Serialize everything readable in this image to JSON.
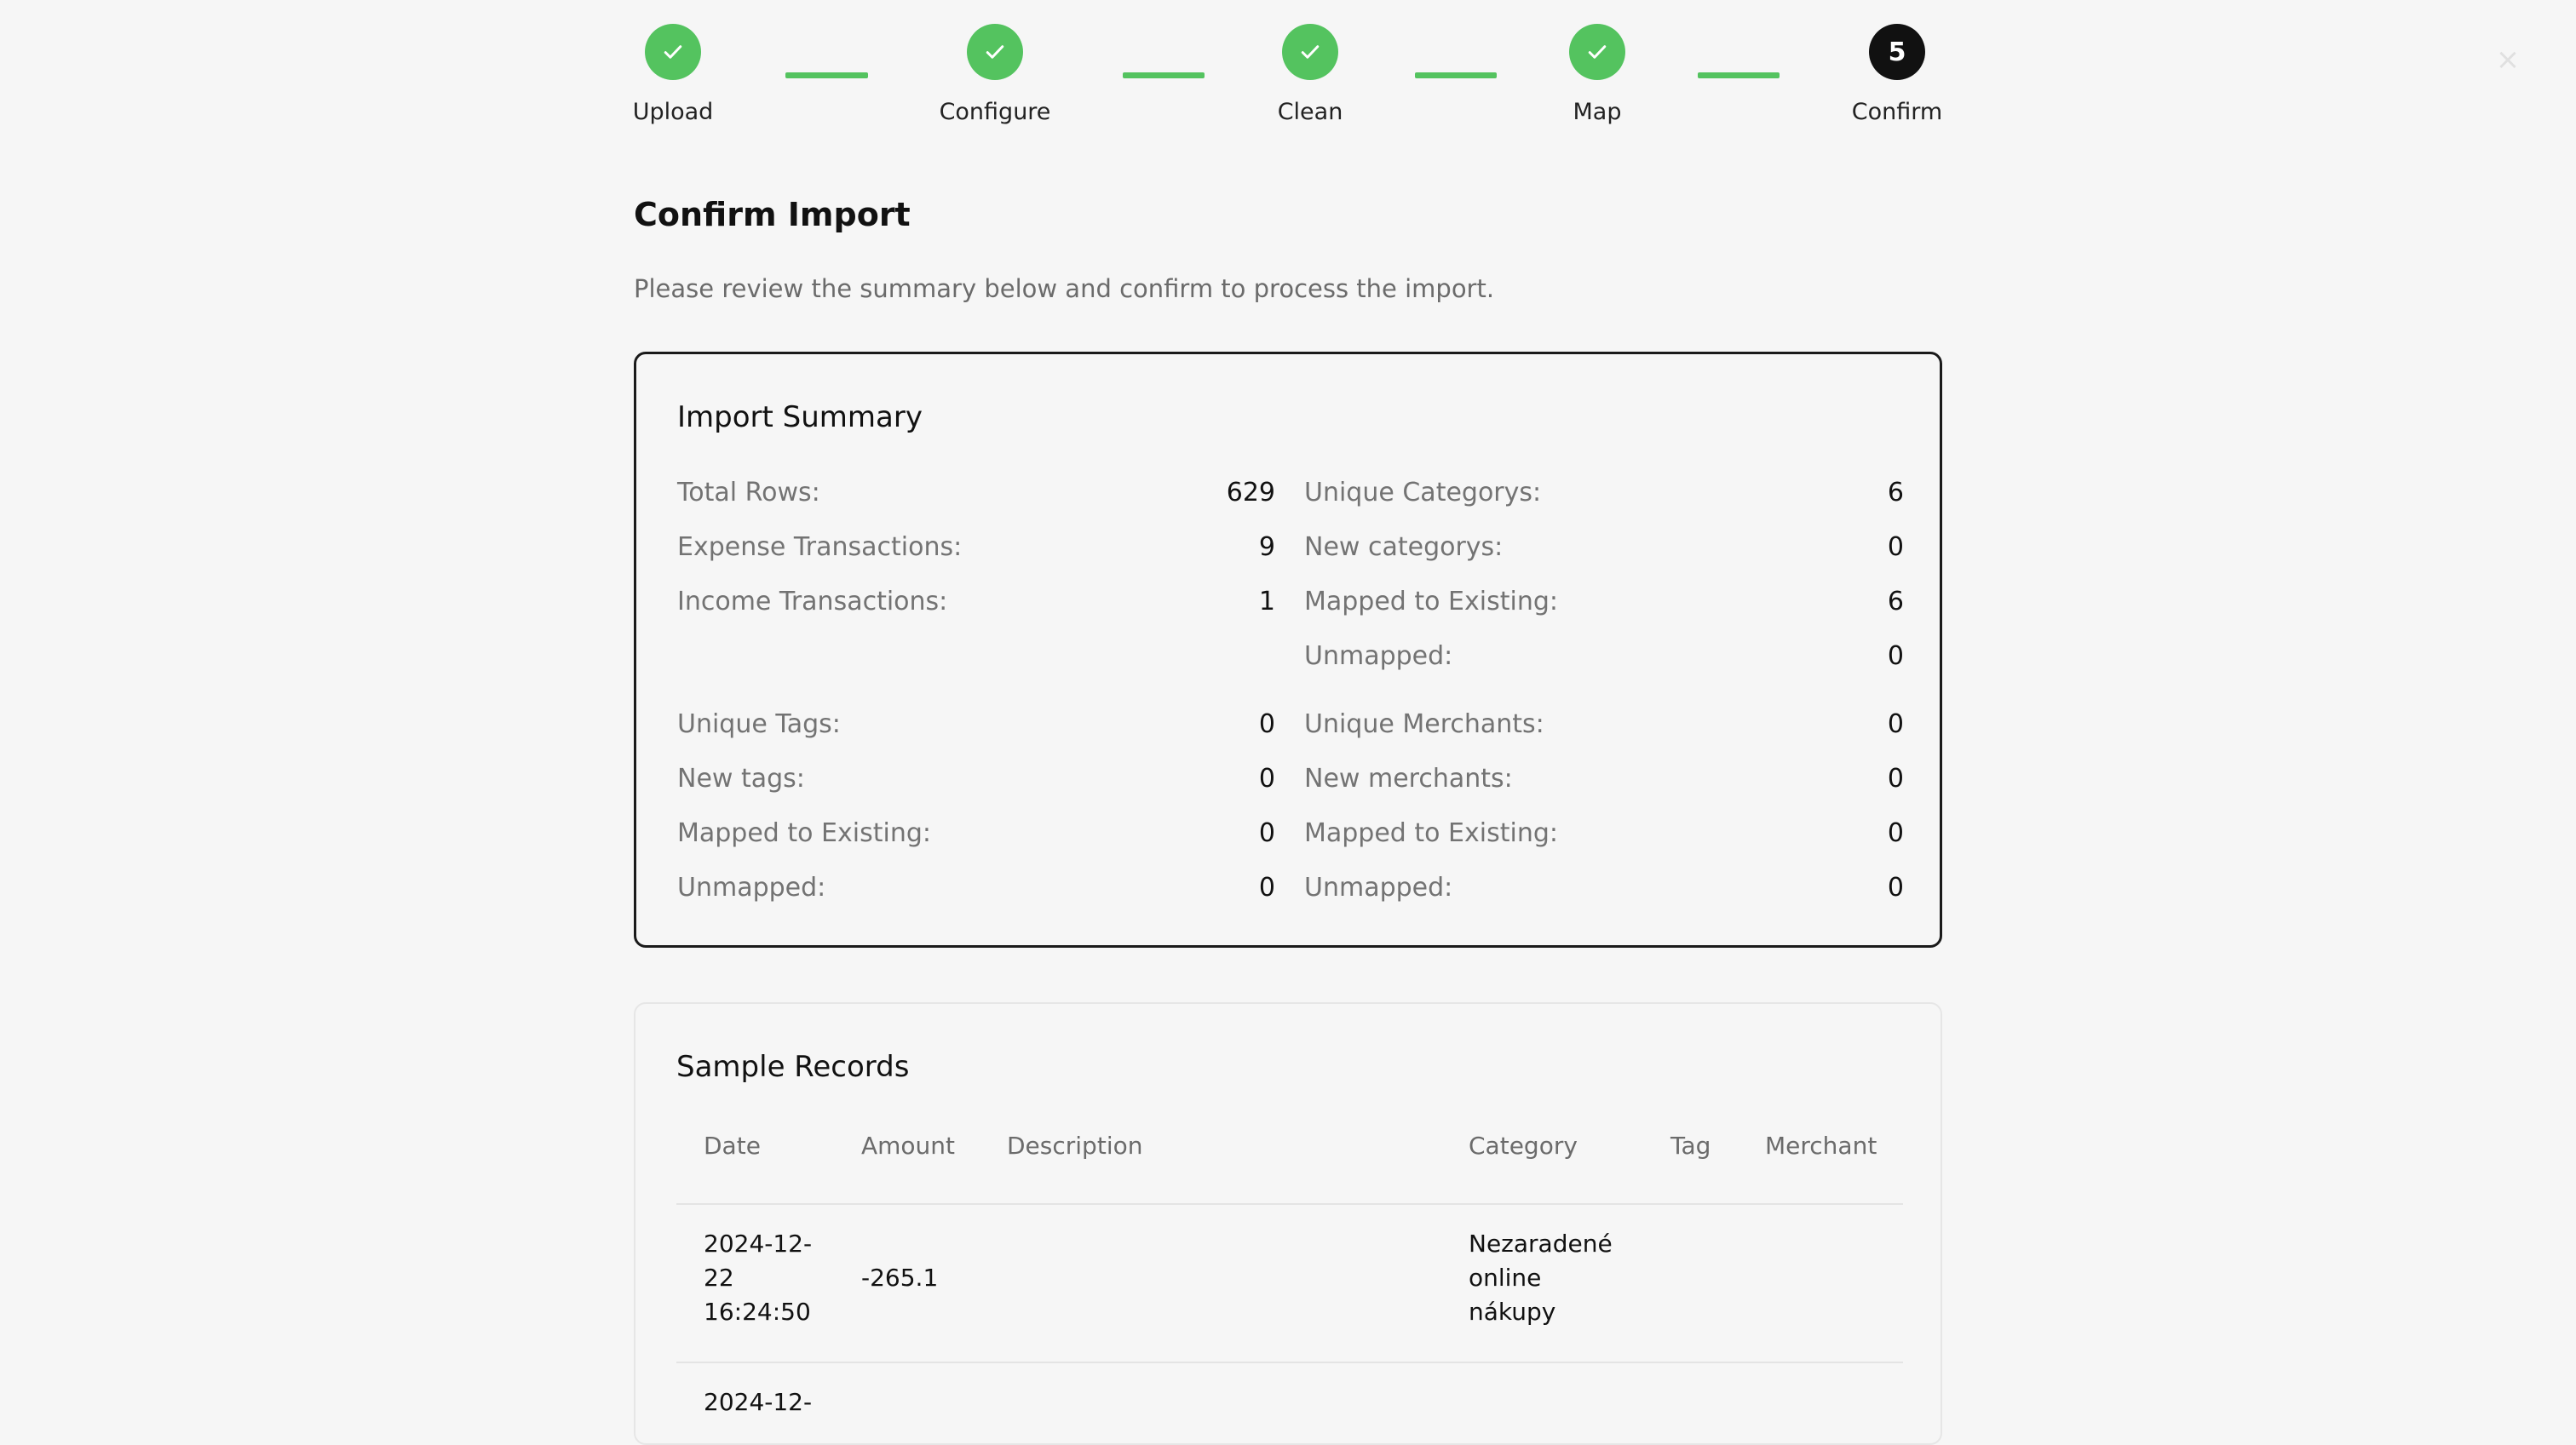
{
  "close_label": "×",
  "steps": [
    {
      "label": "Upload",
      "status": "done"
    },
    {
      "label": "Configure",
      "status": "done"
    },
    {
      "label": "Clean",
      "status": "done"
    },
    {
      "label": "Map",
      "status": "done"
    },
    {
      "label": "Confirm",
      "status": "current",
      "number": "5"
    }
  ],
  "colors": {
    "step_done": "#54c35f",
    "step_current": "#111111"
  },
  "page": {
    "title": "Confirm Import",
    "description": "Please review the summary below and confirm to process the import."
  },
  "summary": {
    "title": "Import Summary",
    "total_rows": {
      "label": "Total Rows:",
      "value": "629"
    },
    "expense_transactions": {
      "label": "Expense Transactions:",
      "value": "9"
    },
    "income_transactions": {
      "label": "Income Transactions:",
      "value": "1"
    },
    "unique_categories": {
      "label": "Unique Categorys:",
      "value": "6"
    },
    "new_categories": {
      "label": "New categorys:",
      "value": "0"
    },
    "categories_mapped": {
      "label": "Mapped to Existing:",
      "value": "6"
    },
    "categories_unmapped": {
      "label": "Unmapped:",
      "value": "0"
    },
    "unique_tags": {
      "label": "Unique Tags:",
      "value": "0"
    },
    "new_tags": {
      "label": "New tags:",
      "value": "0"
    },
    "tags_mapped": {
      "label": "Mapped to Existing:",
      "value": "0"
    },
    "tags_unmapped": {
      "label": "Unmapped:",
      "value": "0"
    },
    "unique_merchants": {
      "label": "Unique Merchants:",
      "value": "0"
    },
    "new_merchants": {
      "label": "New merchants:",
      "value": "0"
    },
    "merchants_mapped": {
      "label": "Mapped to Existing:",
      "value": "0"
    },
    "merchants_unmapped": {
      "label": "Unmapped:",
      "value": "0"
    }
  },
  "sample": {
    "title": "Sample Records",
    "columns": {
      "date": "Date",
      "amount": "Amount",
      "description": "Description",
      "category": "Category",
      "tag": "Tag",
      "merchant": "Merchant"
    },
    "rows": [
      {
        "date_line1": "2024-12-",
        "date_line2": "22",
        "date_line3": "16:24:50",
        "amount": "-265.1",
        "description": "",
        "category_line1": "Nezaradené",
        "category_line2": "online",
        "category_line3": "nákupy",
        "tag": "",
        "merchant": ""
      },
      {
        "date_line1": "2024-12-"
      }
    ]
  }
}
